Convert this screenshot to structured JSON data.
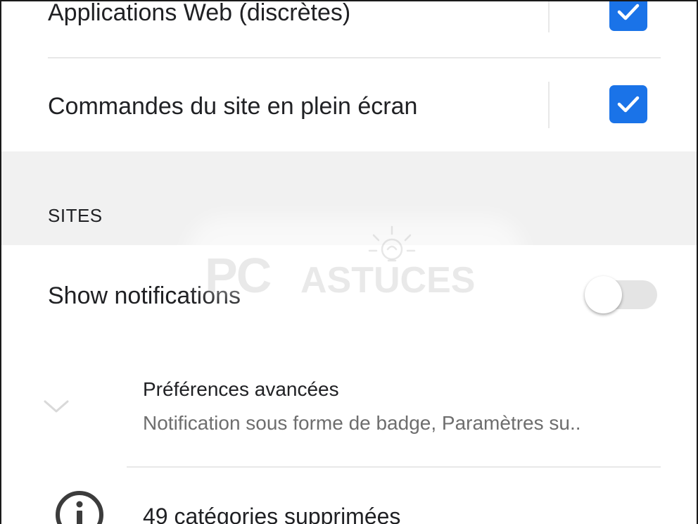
{
  "rows": {
    "web_apps": {
      "label": "Applications Web (discrètes)",
      "checked": true
    },
    "fullscreen": {
      "label": "Commandes du site en plein écran",
      "checked": true
    }
  },
  "section": {
    "header": "SITES"
  },
  "notifications": {
    "label": "Show notifications",
    "enabled": false
  },
  "advanced": {
    "title": "Préférences avancées",
    "subtitle": "Notification sous forme de badge, Paramètres su.."
  },
  "deleted": {
    "label": "49 catégories supprimées"
  },
  "watermark": {
    "text_pc": "PC",
    "text_astuces": "ASTUCES"
  },
  "icons": {
    "checkbox": "check-icon",
    "expand": "chevron-down-icon",
    "info": "info-icon",
    "watermark_bulb": "lightbulb-icon"
  },
  "colors": {
    "accent": "#1a73e8",
    "toggle_track_off": "#e4e4e4",
    "section_band": "#f1f1f1",
    "subtitle_text": "#6e6e6e"
  }
}
